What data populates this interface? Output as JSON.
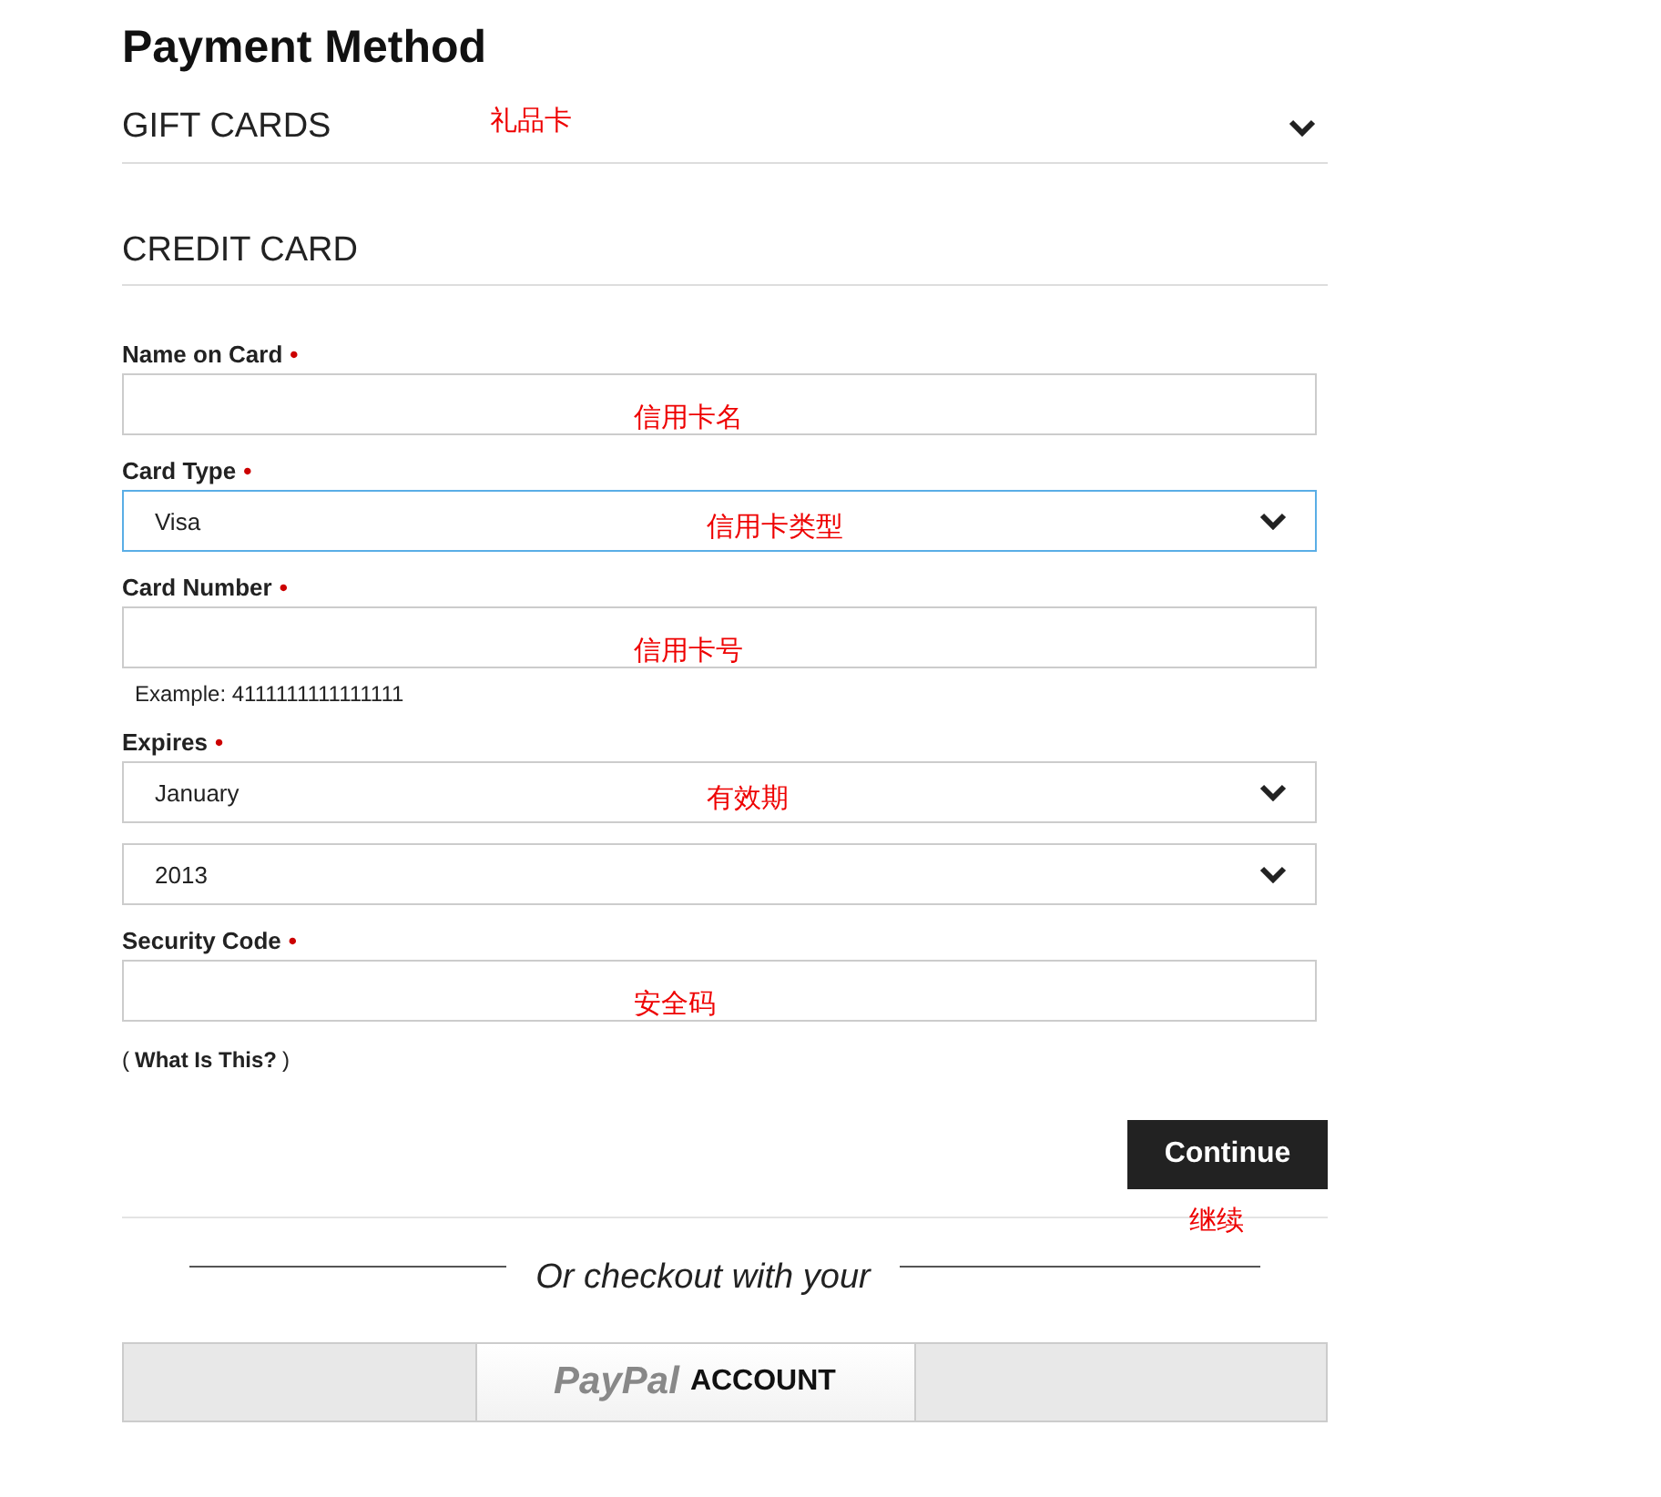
{
  "title": "Payment Method",
  "gift_cards": {
    "title": "GIFT CARDS",
    "annotation": "礼品卡",
    "expanded": false
  },
  "credit_card": {
    "title": "CREDIT CARD"
  },
  "fields": [
    {
      "label": "Name on Card",
      "required_mark": "•",
      "controls": [
        {
          "kind": "text",
          "annotation": "信用卡名"
        }
      ]
    },
    {
      "label": "Card Type",
      "required_mark": "•",
      "controls": [
        {
          "kind": "select",
          "value": "Visa",
          "focused": true,
          "annotation": "信用卡类型"
        }
      ]
    },
    {
      "label": "Card Number",
      "required_mark": "•",
      "controls": [
        {
          "kind": "text",
          "annotation": "信用卡号"
        }
      ],
      "hint": "Example: 4111111111111111"
    },
    {
      "label": "Expires",
      "required_mark": "•",
      "controls": [
        {
          "kind": "select",
          "value": "January",
          "focused": false,
          "annotation": "有效期"
        },
        {
          "kind": "select",
          "value": "2013",
          "focused": false
        }
      ]
    },
    {
      "label": "Security Code",
      "required_mark": "•",
      "controls": [
        {
          "kind": "text",
          "annotation": "安全码"
        }
      ]
    }
  ],
  "help_link": {
    "open": "(",
    "text": "What Is This?",
    "close": ")"
  },
  "continue": {
    "label": "Continue",
    "annotation": "继续"
  },
  "alt_checkout": {
    "text": "Or checkout with your",
    "brand": "PayPal",
    "account": "ACCOUNT"
  }
}
